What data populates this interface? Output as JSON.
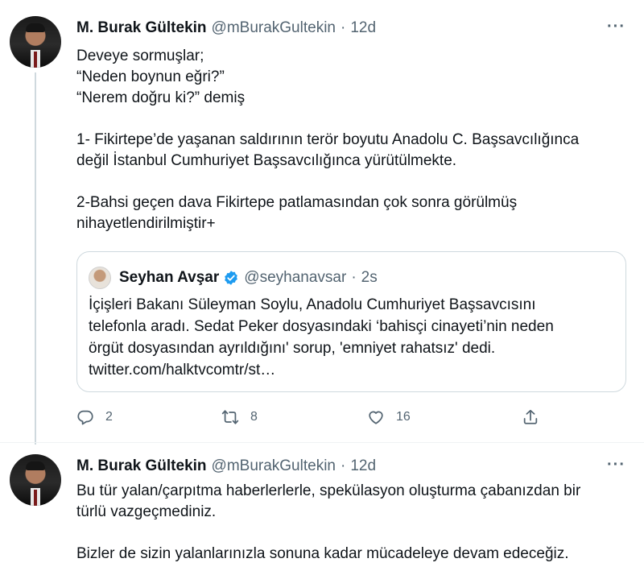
{
  "tweet1": {
    "name": "M. Burak Gültekin",
    "handle": "@mBurakGultekin",
    "time": "12d",
    "more": "···",
    "lines": [
      "Deveye sormuşlar;",
      "“Neden boynun eğri?”",
      "“Nerem doğru ki?” demiş",
      "",
      "1- Fikirtepe’de yaşanan saldırının terör boyutu Anadolu C. Başsavcılığınca",
      "değil İstanbul Cumhuriyet Başsavcılığınca yürütülmekte.",
      "",
      "2-Bahsi geçen dava Fikirtepe patlamasından çok sonra görülmüş",
      "nihayetlendirilmiştir+"
    ],
    "quote": {
      "name": "Seyhan Avşar",
      "handle": "@seyhanavsar",
      "time": "2s",
      "lines": [
        "İçişleri Bakanı Süleyman Soylu, Anadolu Cumhuriyet Başsavcısını",
        "telefonla aradı. Sedat Peker dosyasındaki ‘bahisçi cinayeti’nin neden",
        "örgüt dosyasından ayrıldığını' sorup, 'emniyet rahatsız' dedi.",
        "twitter.com/halktvcomtr/st…"
      ]
    },
    "actions": {
      "reply_count": "2",
      "retweet_count": "8",
      "like_count": "16",
      "icons": [
        "reply-icon",
        "retweet-icon",
        "like-icon",
        "share-icon"
      ]
    }
  },
  "tweet2": {
    "name": "M. Burak Gültekin",
    "handle": "@mBurakGultekin",
    "time": "12d",
    "more": "···",
    "lines": [
      "Bu tür yalan/çarpıtma haberlerlerle, spekülasyon oluşturma çabanızdan bir",
      "türlü vazgeçmediniz.",
      "",
      "Bizler de sizin yalanlarınızla sonuna kadar mücadeleye devam edeceğiz."
    ]
  },
  "colors": {
    "text": "#0f1419",
    "secondary": "#536471",
    "border": "#cfd9de",
    "verified": "#1d9bf0"
  }
}
